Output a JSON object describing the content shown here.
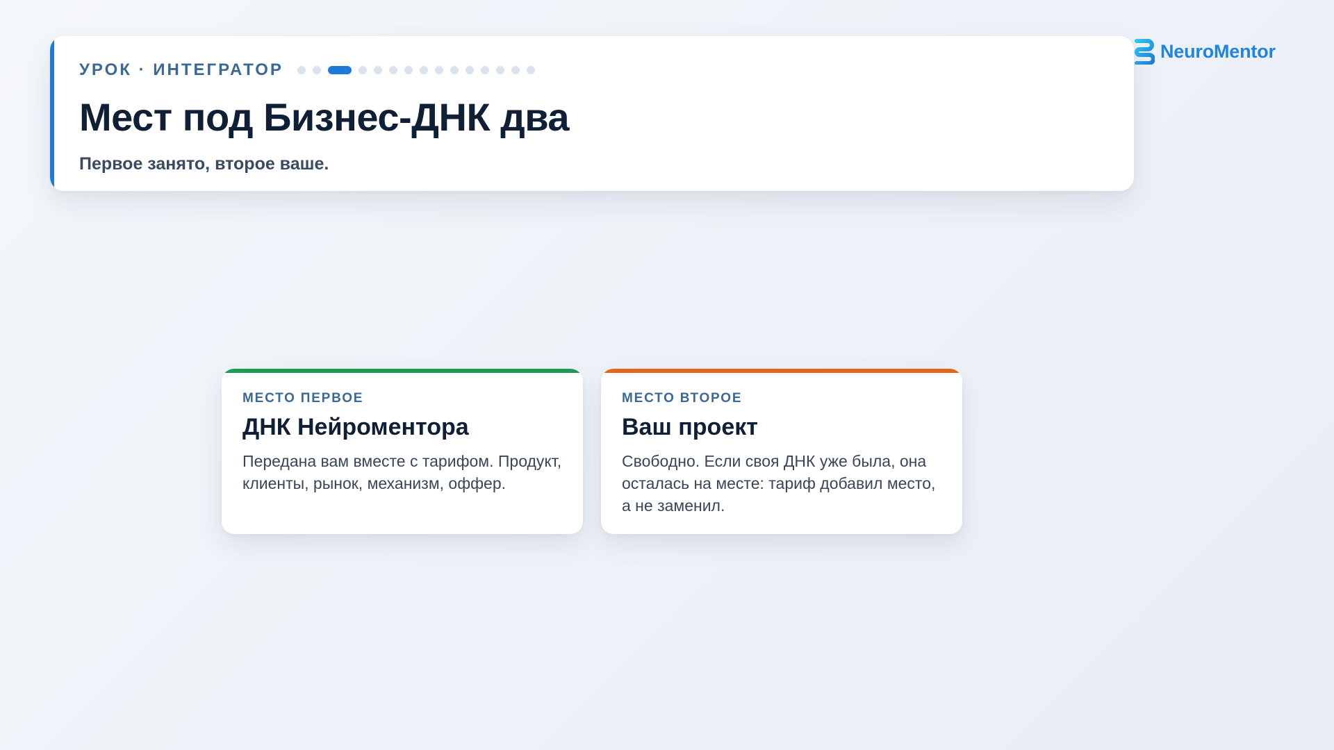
{
  "header": {
    "kicker": "УРОК · ИНТЕГРАТОР",
    "progress": {
      "total": 15,
      "current": 3
    },
    "title": "Мест под Бизнес-ДНК два",
    "subtitle": "Первое занято, второе ваше.",
    "accent_color": "#1f7ad6"
  },
  "brand": {
    "name": "NeuroMentor",
    "icon": "neuromentor-logo-icon",
    "color": "#1f84e0"
  },
  "cards": [
    {
      "label": "МЕСТО ПЕРВОЕ",
      "title": "ДНК Нейроментора",
      "text": "Передана вам вместе с тарифом. Продукт, клиенты, рынок, механизм, оффер.",
      "accent_color": "#1d9a55"
    },
    {
      "label": "МЕСТО ВТОРОЕ",
      "title": "Ваш проект",
      "text": "Свободно. Если своя ДНК уже была, она осталась на месте: тариф добавил место, а не заменил.",
      "accent_color": "#e2661e"
    }
  ]
}
